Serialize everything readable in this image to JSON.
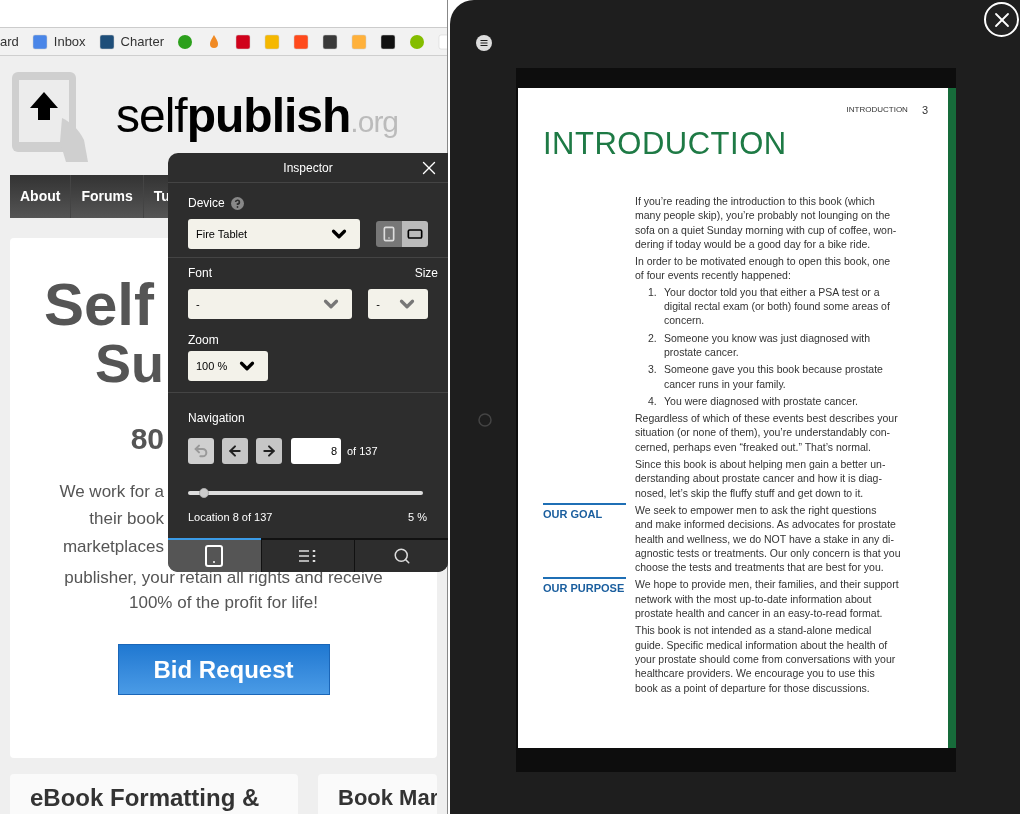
{
  "browser": {
    "bookmarks": [
      {
        "label": "ard"
      },
      {
        "label": "Inbox",
        "color": "#4a86e8",
        "kind": "square"
      },
      {
        "label": "Charter",
        "color": "#1e4e79",
        "kind": "square"
      },
      {
        "color": "#2ca01c",
        "kind": "circle"
      },
      {
        "color": "#f08a24",
        "kind": "drop"
      },
      {
        "color": "#d0021b",
        "kind": "square"
      },
      {
        "color": "#f5b800",
        "kind": "square"
      },
      {
        "color": "#ff4a1c",
        "kind": "square"
      },
      {
        "color": "#3a3a3a",
        "kind": "square"
      },
      {
        "color": "#ffb13b",
        "kind": "square"
      },
      {
        "color": "#111111",
        "kind": "square"
      },
      {
        "color": "#84bd00",
        "kind": "circle"
      },
      {
        "color": "#ffffff",
        "kind": "square"
      }
    ]
  },
  "website": {
    "logo": {
      "light": "self",
      "bold": "publish",
      "suffix": ".org"
    },
    "nav": [
      "About",
      "Forums",
      "Tu"
    ],
    "hero": {
      "title_lines": [
        "Self",
        "Su"
      ],
      "subtitle": "80",
      "paragraph_lines": [
        "We work for a",
        "their book",
        "marketplaces",
        "publisher, your retain all rights and receive",
        "100% of the profit for life!"
      ],
      "button": "Bid Request"
    },
    "cards": [
      "eBook Formatting &",
      "Book Mar"
    ]
  },
  "inspector": {
    "title": "Inspector",
    "device": {
      "label": "Device",
      "value": "Fire Tablet",
      "orientations": [
        {
          "kind": "portrait",
          "selected": true
        },
        {
          "kind": "landscape",
          "selected": false
        }
      ]
    },
    "font": {
      "label": "Font",
      "value": "-",
      "disabled": true
    },
    "size": {
      "label": "Size",
      "value": "-",
      "disabled": true
    },
    "zoom": {
      "label": "Zoom",
      "value": "100 %"
    },
    "navigation": {
      "label": "Navigation",
      "buttons": [
        {
          "kind": "back",
          "disabled": true
        },
        {
          "kind": "previous",
          "disabled": false
        },
        {
          "kind": "next",
          "disabled": false
        }
      ],
      "page": "8",
      "of": "of 137",
      "level": 0.07,
      "location": "Location 8 of 137",
      "percent": "5 %"
    },
    "tabs": [
      {
        "kind": "device",
        "selected": true
      },
      {
        "kind": "contents",
        "selected": false
      },
      {
        "kind": "search",
        "selected": false
      }
    ]
  },
  "viewer": {
    "page": {
      "running_head": "INTRODUCTION",
      "page_number": "3",
      "title": "INTRODUCTION",
      "blocks": [
        {
          "kind": "paragraph",
          "text": "If you’re reading the introduction to this book (which\nmany people skip), you’re probably not lounging on the\nsofa on a quiet Sunday morning with cup of coffee, won-\ndering if today would be a good day for a bike ride."
        },
        {
          "kind": "paragraph",
          "text": "In order to be motivated enough to open this book, one\nof four events recently happened:"
        },
        {
          "kind": "list",
          "items": [
            {
              "number": "1.",
              "text": "Your doctor told you that either a PSA test or a\ndigital rectal exam (or both) found some areas of\nconcern."
            },
            {
              "number": "2.",
              "text": "Someone you know was just diagnosed with\nprostate cancer."
            },
            {
              "number": "3.",
              "text": "Someone gave you this book because prostate\ncancer runs in your family."
            },
            {
              "number": "4.",
              "text": "You were diagnosed with prostate cancer."
            }
          ]
        },
        {
          "kind": "paragraph",
          "text": "Regardless of which of these events best describes your\nsituation (or none of them), you’re understandably con-\ncerned, perhaps even “freaked out.” That’s normal."
        },
        {
          "kind": "paragraph",
          "text": "Since this book is about helping men gain a better un-\nderstanding about prostate cancer and how it is diag-\nnosed, let’s skip the fluffy stuff and get down to it."
        },
        {
          "kind": "paragraph",
          "side_heading": "OUR GOAL",
          "text": "We seek to empower men to ask the right questions\nand make informed decisions. As advocates for prostate\nhealth and wellness, we do NOT have a stake in any di-\nagnostic tests or treatments. Our only concern is that you\nchoose the tests and treatments that are best for you."
        },
        {
          "kind": "paragraph",
          "side_heading": "OUR PURPOSE",
          "text": "We hope to provide men, their families, and their support\nnetwork with the most up-to-date information about\nprostate health and cancer in an easy-to-read format."
        },
        {
          "kind": "paragraph",
          "text": "This book is not intended as a stand-alone medical\nguide. Specific medical information about the health of\nyour prostate should come from conversations with your\nhealthcare providers. We encourage you to use this\nbook as a point of departure for those discussions."
        }
      ]
    }
  }
}
